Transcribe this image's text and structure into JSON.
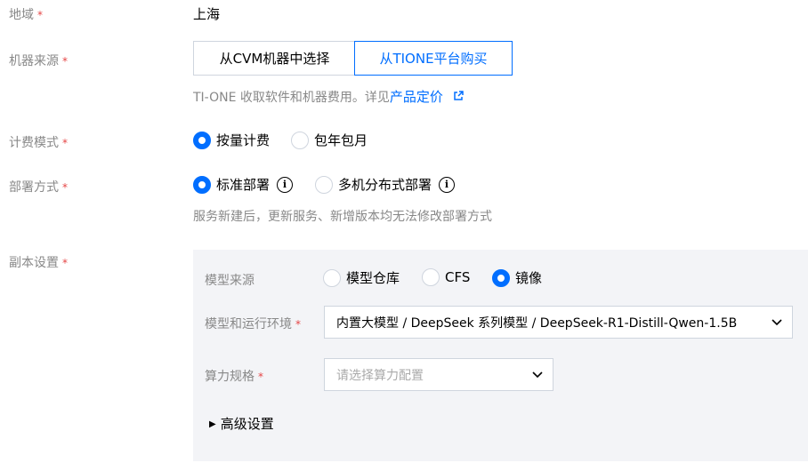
{
  "region": {
    "label": "地域",
    "required_mark": "*",
    "value": "上海"
  },
  "machine_source": {
    "label": "机器来源",
    "required_mark": "*",
    "options": [
      {
        "label": "从CVM机器中选择",
        "active": false
      },
      {
        "label": "从TIONE平台购买",
        "active": true
      }
    ],
    "hint_prefix": "TI-ONE 收取软件和机器费用。详见",
    "hint_link": "产品定价",
    "link_icon": "external-link-icon"
  },
  "billing_mode": {
    "label": "计费模式",
    "required_mark": "*",
    "options": [
      {
        "label": "按量计费",
        "checked": true
      },
      {
        "label": "包年包月",
        "checked": false
      }
    ]
  },
  "deploy_mode": {
    "label": "部署方式",
    "required_mark": "*",
    "options": [
      {
        "label": "标准部署",
        "checked": true,
        "info_icon": "i"
      },
      {
        "label": "多机分布式部署",
        "checked": false,
        "info_icon": "i"
      }
    ],
    "hint": "服务新建后，更新服务、新增版本均无法修改部署方式"
  },
  "replica": {
    "label": "副本设置",
    "required_mark": "*",
    "model_source": {
      "label": "模型来源",
      "options": [
        {
          "label": "模型仓库",
          "checked": false
        },
        {
          "label": "CFS",
          "checked": false
        },
        {
          "label": "镜像",
          "checked": true
        }
      ]
    },
    "model_env": {
      "label": "模型和运行环境",
      "required_mark": "*",
      "value": "内置大模型 / DeepSeek 系列模型 / DeepSeek-R1-Distill-Qwen-1.5B"
    },
    "compute_spec": {
      "label": "算力规格",
      "required_mark": "*",
      "placeholder": "请选择算力配置"
    },
    "advanced": {
      "arrow": "▶",
      "label": "高级设置"
    }
  },
  "colors": {
    "accent": "#006eff",
    "required": "#e54545",
    "muted": "#888888",
    "panel_bg": "#f3f4f7",
    "border": "#cfd5de"
  }
}
